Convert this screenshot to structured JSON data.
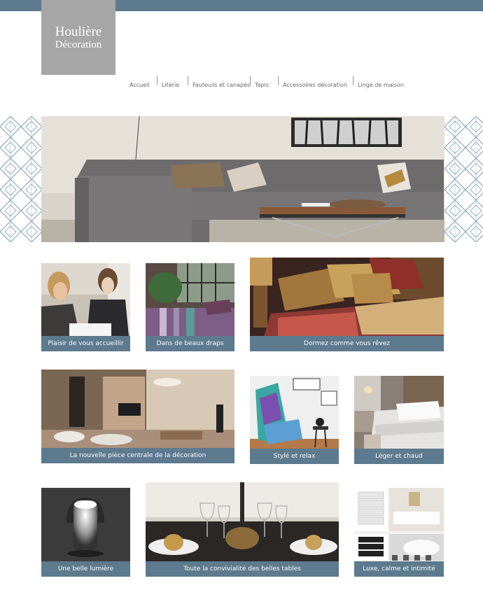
{
  "brand": {
    "line1": "Houlière",
    "line2": "Décoration"
  },
  "nav": {
    "items": [
      {
        "label": "Accueil"
      },
      {
        "label": "Literie"
      },
      {
        "label": "Fauteuils et canapés"
      },
      {
        "label": "Tapis"
      },
      {
        "label": "Accessoires décoration"
      },
      {
        "label": "Linge de maison"
      }
    ]
  },
  "tiles": [
    {
      "caption": "Plaisir de vous accueillir"
    },
    {
      "caption": "Dans de beaux draps"
    },
    {
      "caption": "Dormez comme vous rêvez"
    },
    {
      "caption": "La nouvelle pièce centrale de la décoration"
    },
    {
      "caption": "Stylé et relax"
    },
    {
      "caption": "Léger et chaud"
    },
    {
      "caption": "Une belle lumière"
    },
    {
      "caption": "Toute la convivialité des belles tables"
    },
    {
      "caption": "Luxe, calme et intimité"
    }
  ],
  "colors": {
    "accent": "#5d7a8e",
    "logo_bg": "#a6a6a6",
    "pattern_line": "#7f9cb5"
  }
}
